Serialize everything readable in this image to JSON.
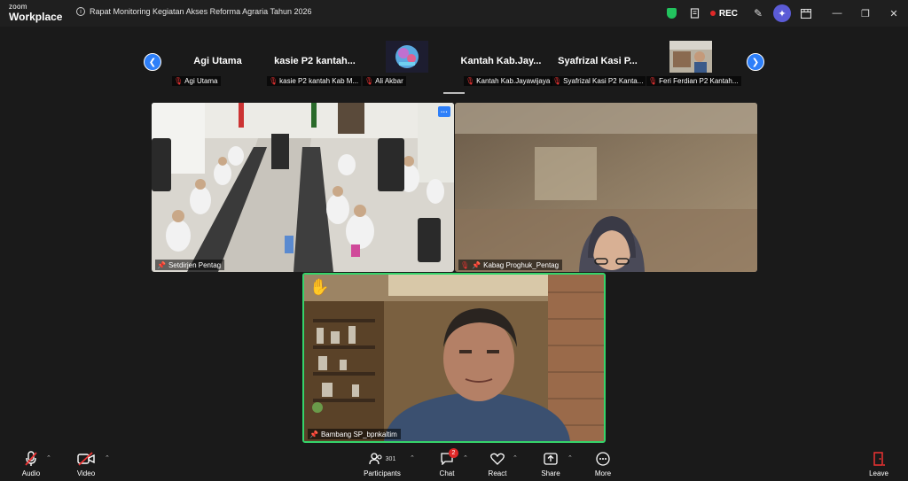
{
  "app": {
    "brand_top": "zoom",
    "brand_bottom": "Workplace"
  },
  "meeting": {
    "title": "Rapat Monitoring Kegiatan Akses Reforma Agraria Tahun 2026"
  },
  "titlebar": {
    "rec_label": "REC",
    "rec_color": "#e02828",
    "shield_color": "#22c35e"
  },
  "strip": {
    "tiles": [
      {
        "big_name": "Agi Utama",
        "label": "Agi Utama",
        "muted": true
      },
      {
        "big_name": "kasie P2 kantah...",
        "label": "kasie P2 kantah Kab M...",
        "muted": true
      },
      {
        "big_name": "",
        "label": "Ali Akbar",
        "muted": true
      },
      {
        "big_name": "Kantah Kab.Jay...",
        "label": "Kantah Kab.Jayawijaya",
        "muted": true
      },
      {
        "big_name": "Syafrizal Kasi P...",
        "label": "Syafrizal Kasi P2 Kanta...",
        "muted": true
      },
      {
        "big_name": "",
        "label": "Feri Ferdian P2 Kantah...",
        "muted": true
      }
    ]
  },
  "videos": {
    "tile1": {
      "name": "Setdirjen Pentag"
    },
    "tile2": {
      "name": "Kabag Proghuk_Pentag"
    },
    "tile3": {
      "name": "Bambang SP_bpnkaltim"
    }
  },
  "toolbar": {
    "audio_label": "Audio",
    "video_label": "Video",
    "participants_label": "Participants",
    "participants_count": "301",
    "chat_label": "Chat",
    "chat_badge": "2",
    "react_label": "React",
    "share_label": "Share",
    "more_label": "More",
    "leave_label": "Leave",
    "accent_color": "#2d7ff9",
    "active_speaker_color": "#35d46a"
  }
}
